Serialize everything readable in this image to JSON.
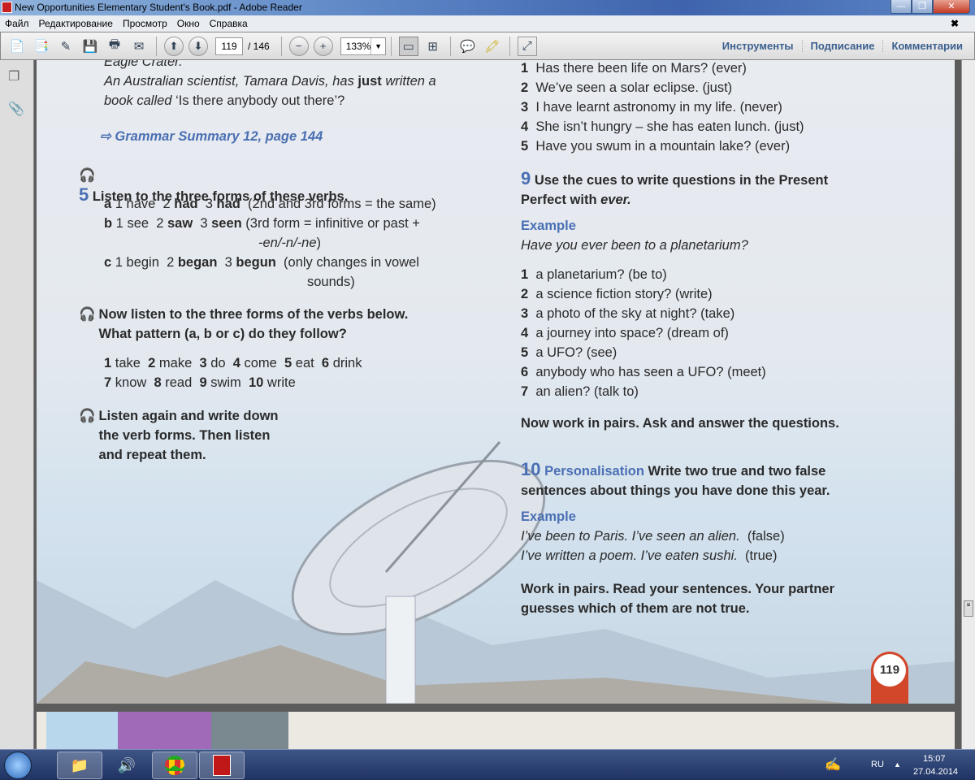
{
  "window": {
    "title": "New Opportunities Elementary Student's Book.pdf - Adobe Reader",
    "min": "—",
    "max": "❐",
    "close": "✕"
  },
  "menu": [
    "Файл",
    "Редактирование",
    "Просмотр",
    "Окно",
    "Справка"
  ],
  "menu_close": "✖",
  "toolbar": {
    "page_current": "119",
    "page_total": "/ 146",
    "zoom": "133%",
    "tabs": [
      "Инструменты",
      "Подписание",
      "Комментарии"
    ]
  },
  "page": {
    "number": "119",
    "blocks": {
      "intro": [
        [
          [
            "Eagle Crater.",
            "i"
          ]
        ],
        [
          [
            "An Australian scientist, Tamara Davis, has ",
            "i"
          ],
          [
            "just",
            "b"
          ],
          [
            " written a",
            "i"
          ]
        ],
        [
          [
            "book called",
            "i"
          ],
          [
            " ‘Is there anybody out there’?",
            "n"
          ]
        ]
      ],
      "grammar": [
        [
          [
            "⇨ Grammar Summary 12, page 144",
            "bluei"
          ]
        ]
      ],
      "ex5": [
        [
          [
            "5",
            "num"
          ],
          [
            " Listen to the three forms of these verbs.",
            "b"
          ]
        ]
      ],
      "ex5list": [
        [
          [
            "a",
            "b"
          ],
          [
            " 1 have  2 ",
            "n"
          ],
          [
            "had",
            "b"
          ],
          [
            "  3 ",
            "n"
          ],
          [
            "had",
            "b"
          ],
          [
            "  (2nd and 3rd forms = the same)",
            "n"
          ]
        ],
        [
          [
            "b",
            "b"
          ],
          [
            " 1 see  2 ",
            "n"
          ],
          [
            "saw",
            "b"
          ],
          [
            "  3 ",
            "n"
          ],
          [
            "seen",
            "b"
          ],
          [
            " (3rd form = infinitive or past +",
            "n"
          ]
        ],
        [
          [
            "-en/-n/-ne",
            "i",
            1
          ],
          [
            ")",
            "n"
          ]
        ],
        [
          [
            "c",
            "b"
          ],
          [
            " 1 begin  2 ",
            "n"
          ],
          [
            "began",
            "b"
          ],
          [
            "  3 ",
            "n"
          ],
          [
            "begun",
            "b"
          ],
          [
            "  (only changes in vowel",
            "n"
          ]
        ],
        [
          [
            "sounds)",
            "n",
            2
          ]
        ]
      ],
      "nowlisten": [
        [
          [
            "Now listen to the three forms of the verbs below.",
            "b"
          ]
        ],
        [
          [
            "What pattern (a, b or c) do they follow?",
            "b"
          ]
        ]
      ],
      "verbs": [
        [
          [
            "1",
            "b"
          ],
          [
            " take  ",
            "n"
          ],
          [
            "2",
            "b"
          ],
          [
            " make  ",
            "n"
          ],
          [
            "3",
            "b"
          ],
          [
            " do  ",
            "n"
          ],
          [
            "4",
            "b"
          ],
          [
            " come  ",
            "n"
          ],
          [
            "5",
            "b"
          ],
          [
            " eat  ",
            "n"
          ],
          [
            "6",
            "b"
          ],
          [
            " drink",
            "n"
          ]
        ],
        [
          [
            "7",
            "b"
          ],
          [
            " know  ",
            "n"
          ],
          [
            "8",
            "b"
          ],
          [
            " read  ",
            "n"
          ],
          [
            "9",
            "b"
          ],
          [
            " swim  ",
            "n"
          ],
          [
            "10",
            "b"
          ],
          [
            " write",
            "n"
          ]
        ]
      ],
      "listenagain": [
        [
          [
            "Listen again and write down",
            "b"
          ]
        ],
        [
          [
            "the verb forms. Then listen",
            "b"
          ]
        ],
        [
          [
            "and repeat them.",
            "b"
          ]
        ]
      ],
      "ex8list": [
        [
          [
            "1",
            "b"
          ],
          [
            "  Has there been life on Mars? (ever)",
            "n"
          ]
        ],
        [
          [
            "2",
            "b"
          ],
          [
            "  We’ve seen a solar eclipse. (just)",
            "n"
          ]
        ],
        [
          [
            "3",
            "b"
          ],
          [
            "  I have learnt astronomy in my life. (never)",
            "n"
          ]
        ],
        [
          [
            "4",
            "b"
          ],
          [
            "  She isn’t hungry – she has eaten lunch. (just)",
            "n"
          ]
        ],
        [
          [
            "5",
            "b"
          ],
          [
            "  Have you swum in a mountain lake? (ever)",
            "n"
          ]
        ]
      ],
      "ex9": [
        [
          [
            "9",
            "num"
          ],
          [
            " Use the cues to write questions in the Present",
            "b"
          ]
        ],
        [
          [
            "Perfect with ",
            "b"
          ],
          [
            "ever.",
            "b i"
          ]
        ]
      ],
      "ex9example": [
        [
          [
            "Example",
            "blue"
          ]
        ],
        [
          [
            "Have you ever been to a planetarium?",
            "i"
          ]
        ]
      ],
      "ex9list": [
        [
          [
            "1",
            "b"
          ],
          [
            "  a planetarium? (be to)",
            "n"
          ]
        ],
        [
          [
            "2",
            "b"
          ],
          [
            "  a science fiction story? (write)",
            "n"
          ]
        ],
        [
          [
            "3",
            "b"
          ],
          [
            "  a photo of the sky at night? (take)",
            "n"
          ]
        ],
        [
          [
            "4",
            "b"
          ],
          [
            "  a journey into space? (dream of)",
            "n"
          ]
        ],
        [
          [
            "5",
            "b"
          ],
          [
            "  a UFO? (see)",
            "n"
          ]
        ],
        [
          [
            "6",
            "b"
          ],
          [
            "  anybody who has seen a UFO? (meet)",
            "n"
          ]
        ],
        [
          [
            "7",
            "b"
          ],
          [
            "  an alien? (talk to)",
            "n"
          ]
        ]
      ],
      "nowwork": [
        [
          [
            "Now work in pairs. Ask and answer the questions.",
            "b"
          ]
        ]
      ],
      "ex10": [
        [
          [
            "10",
            "num"
          ],
          [
            " Personalisation",
            "blue"
          ],
          [
            " Write two true and two false",
            "b"
          ]
        ],
        [
          [
            "sentences about things you have done this year.",
            "b"
          ]
        ]
      ],
      "ex10example": [
        [
          [
            "Example",
            "blue"
          ]
        ],
        [
          [
            "I’ve been to Paris. I’ve seen an alien.",
            "i"
          ],
          [
            "  (false)",
            "n"
          ]
        ],
        [
          [
            "I’ve written a poem. I’ve eaten sushi.",
            "i"
          ],
          [
            "  (true)",
            "n"
          ]
        ]
      ],
      "workpairs": [
        [
          [
            "Work in pairs. Read your sentences. Your partner",
            "b"
          ]
        ],
        [
          [
            "guesses which of them are not true.",
            "b"
          ]
        ]
      ]
    }
  },
  "taskbar": {
    "lang": "RU",
    "time": "15:07",
    "date": "27.04.2014"
  }
}
